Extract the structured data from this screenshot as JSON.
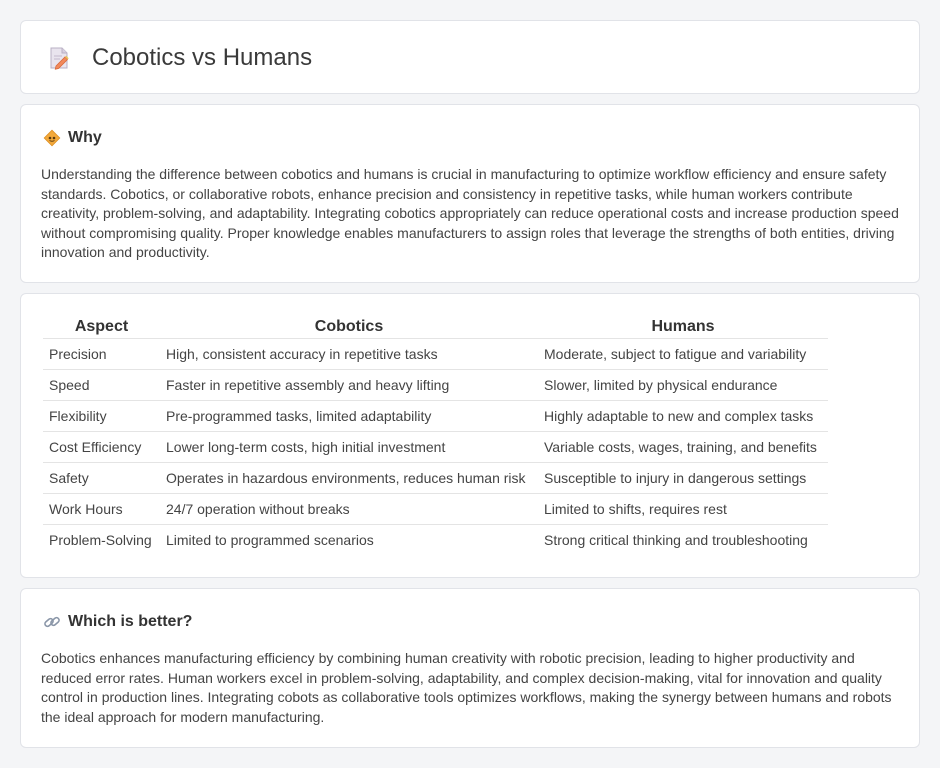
{
  "header": {
    "title": "Cobotics vs Humans",
    "icon": "document-pencil-icon"
  },
  "why": {
    "heading": "Why",
    "icon": "warning-diamond-icon",
    "text": "Understanding the difference between cobotics and humans is crucial in manufacturing to optimize workflow efficiency and ensure safety standards. Cobotics, or collaborative robots, enhance precision and consistency in repetitive tasks, while human workers contribute creativity, problem-solving, and adaptability. Integrating cobotics appropriately can reduce operational costs and increase production speed without compromising quality. Proper knowledge enables manufacturers to assign roles that leverage the strengths of both entities, driving innovation and productivity."
  },
  "table": {
    "headers": [
      "Aspect",
      "Cobotics",
      "Humans"
    ],
    "rows": [
      [
        "Precision",
        "High, consistent accuracy in repetitive tasks",
        "Moderate, subject to fatigue and variability"
      ],
      [
        "Speed",
        "Faster in repetitive assembly and heavy lifting",
        "Slower, limited by physical endurance"
      ],
      [
        "Flexibility",
        "Pre-programmed tasks, limited adaptability",
        "Highly adaptable to new and complex tasks"
      ],
      [
        "Cost Efficiency",
        "Lower long-term costs, high initial investment",
        "Variable costs, wages, training, and benefits"
      ],
      [
        "Safety",
        "Operates in hazardous environments, reduces human risk",
        "Susceptible to injury in dangerous settings"
      ],
      [
        "Work Hours",
        "24/7 operation without breaks",
        "Limited to shifts, requires rest"
      ],
      [
        "Problem-Solving",
        "Limited to programmed scenarios",
        "Strong critical thinking and troubleshooting"
      ]
    ]
  },
  "better": {
    "heading": "Which is better?",
    "icon": "link-icon",
    "text": "Cobotics enhances manufacturing efficiency by combining human creativity with robotic precision, leading to higher productivity and reduced error rates. Human workers excel in problem-solving, adaptability, and complex decision-making, vital for innovation and quality control in production lines. Integrating cobots as collaborative tools optimizes workflows, making the synergy between humans and robots the ideal approach for modern manufacturing."
  }
}
